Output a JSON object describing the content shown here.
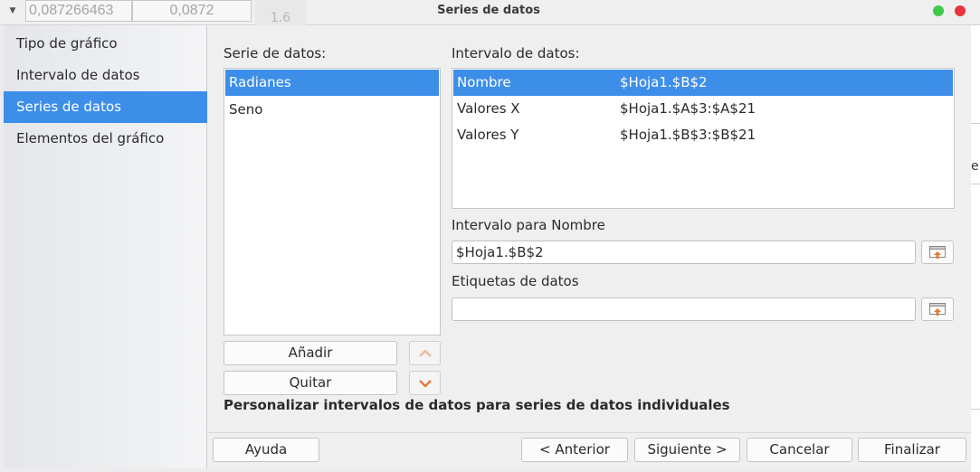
{
  "background": {
    "cell1": "0,087266463",
    "cell2": "0,0872",
    "gray_col": "1.6",
    "right_edge": "e"
  },
  "window": {
    "title": "Series de datos"
  },
  "sidebar": {
    "items": [
      {
        "label": "Tipo de gráfico"
      },
      {
        "label": "Intervalo de datos"
      },
      {
        "label": "Series de datos"
      },
      {
        "label": "Elementos del gráfico"
      }
    ],
    "active_index": 2
  },
  "series": {
    "label": "Serie de datos:",
    "items": [
      {
        "label": "Radianes"
      },
      {
        "label": "Seno"
      }
    ],
    "selected_index": 0,
    "add_label": "Añadir",
    "remove_label": "Quitar"
  },
  "ranges": {
    "label": "Intervalo de datos:",
    "rows": [
      {
        "name": "Nombre",
        "value": "$Hoja1.$B$2"
      },
      {
        "name": "Valores X",
        "value": "$Hoja1.$A$3:$A$21"
      },
      {
        "name": "Valores Y",
        "value": "$Hoja1.$B$3:$B$21"
      }
    ],
    "selected_index": 0
  },
  "name_range": {
    "label": "Intervalo para Nombre",
    "value": "$Hoja1.$B$2"
  },
  "data_labels": {
    "label": "Etiquetas de datos",
    "value": ""
  },
  "hint": "Personalizar intervalos de datos para series de datos individuales",
  "footer": {
    "help": "Ayuda",
    "back": "< Anterior",
    "next": "Siguiente >",
    "cancel": "Cancelar",
    "finish": "Finalizar"
  },
  "colors": {
    "selection": "#3d8ee9",
    "arrow_accent": "#e07a3a",
    "close": "#e8353b",
    "maximize": "#3fc94a"
  }
}
